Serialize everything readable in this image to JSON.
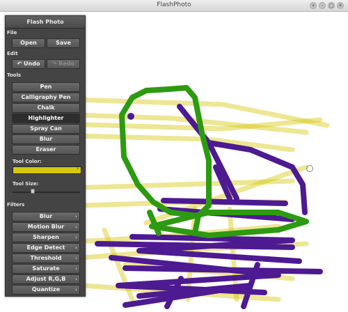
{
  "window": {
    "title": "FlashPhoto",
    "controls": [
      "+",
      "–",
      "□",
      "✕"
    ]
  },
  "panel": {
    "title": "Flash Photo",
    "file": {
      "label": "File",
      "open": "Open",
      "save": "Save"
    },
    "edit": {
      "label": "Edit",
      "undo": "Undo",
      "redo": "Redo",
      "undo_icon": "undo-arrow-icon",
      "redo_icon": "redo-arrow-icon"
    },
    "tools": {
      "label": "Tools",
      "items": [
        "Pen",
        "Calligraphy Pen",
        "Chalk",
        "Highlighter",
        "Spray Can",
        "Blur",
        "Eraser"
      ],
      "selected": "Highlighter"
    },
    "tool_color": {
      "label": "Tool Color:",
      "value": "#d7c710"
    },
    "tool_size": {
      "label": "Tool Size:",
      "fraction": 0.3
    },
    "filters": {
      "label": "Filters",
      "items": [
        "Blur",
        "Motion Blur",
        "Sharpen",
        "Edge Detect",
        "Threshold",
        "Saturate",
        "Adjust R,G,B",
        "Quantize"
      ]
    }
  },
  "colors": {
    "highlighter": "#d7c710",
    "green_pen": "#2d9a12",
    "purple_pen": "#4d1a91",
    "panel_bg": "#444444"
  }
}
